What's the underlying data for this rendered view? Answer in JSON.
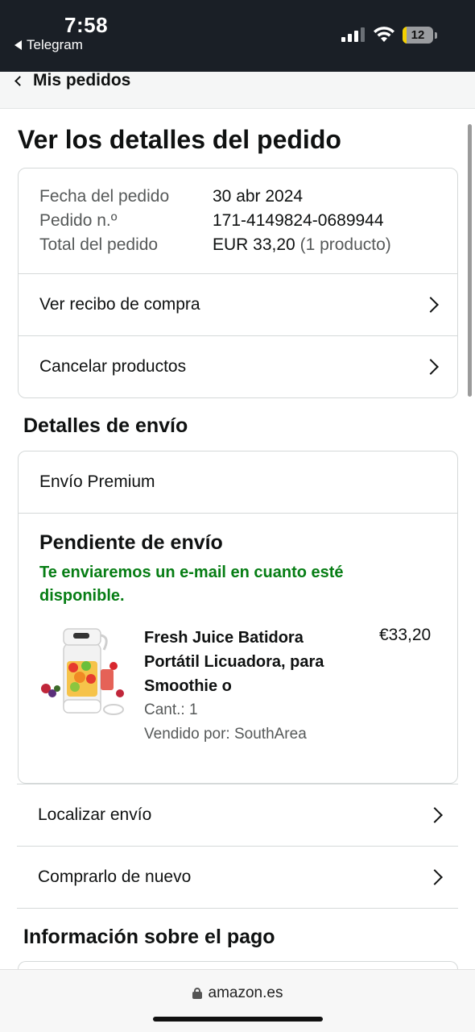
{
  "status_bar": {
    "time": "7:58",
    "back_app": "Telegram",
    "battery_level": "12",
    "battery_fraction": 0.12
  },
  "nav": {
    "back_label": "Mis pedidos"
  },
  "page": {
    "title": "Ver los detalles del pedido"
  },
  "order": {
    "rows": [
      {
        "label": "Fecha del pedido",
        "value": "30 abr 2024",
        "extra": ""
      },
      {
        "label": "Pedido n.º",
        "value": "171-4149824-0689944",
        "extra": ""
      },
      {
        "label": "Total del pedido",
        "value": "EUR 33,20",
        "extra": "(1 producto)"
      }
    ],
    "links": [
      {
        "label": "Ver recibo de compra"
      },
      {
        "label": "Cancelar productos"
      }
    ]
  },
  "shipping": {
    "section_title": "Detalles de envío",
    "type": "Envío Premium",
    "status_title": "Pendiente de envío",
    "status_message": "Te enviaremos un e-mail en cuanto esté disponible.",
    "product": {
      "title": "Fresh Juice Batidora Portátil Licuadora, para Smoothie o",
      "price": "€33,20",
      "quantity": "Cant.: 1",
      "seller": "Vendido por: SouthArea"
    },
    "links": [
      {
        "label": "Localizar envío"
      },
      {
        "label": "Comprarlo de nuevo"
      }
    ]
  },
  "payment": {
    "section_title": "Información sobre el pago"
  },
  "browser": {
    "url": "amazon.es"
  },
  "colors": {
    "status_bg": "#1a1f26",
    "success_green": "#067d14",
    "border": "#d5d9d9",
    "muted_text": "#565959"
  }
}
